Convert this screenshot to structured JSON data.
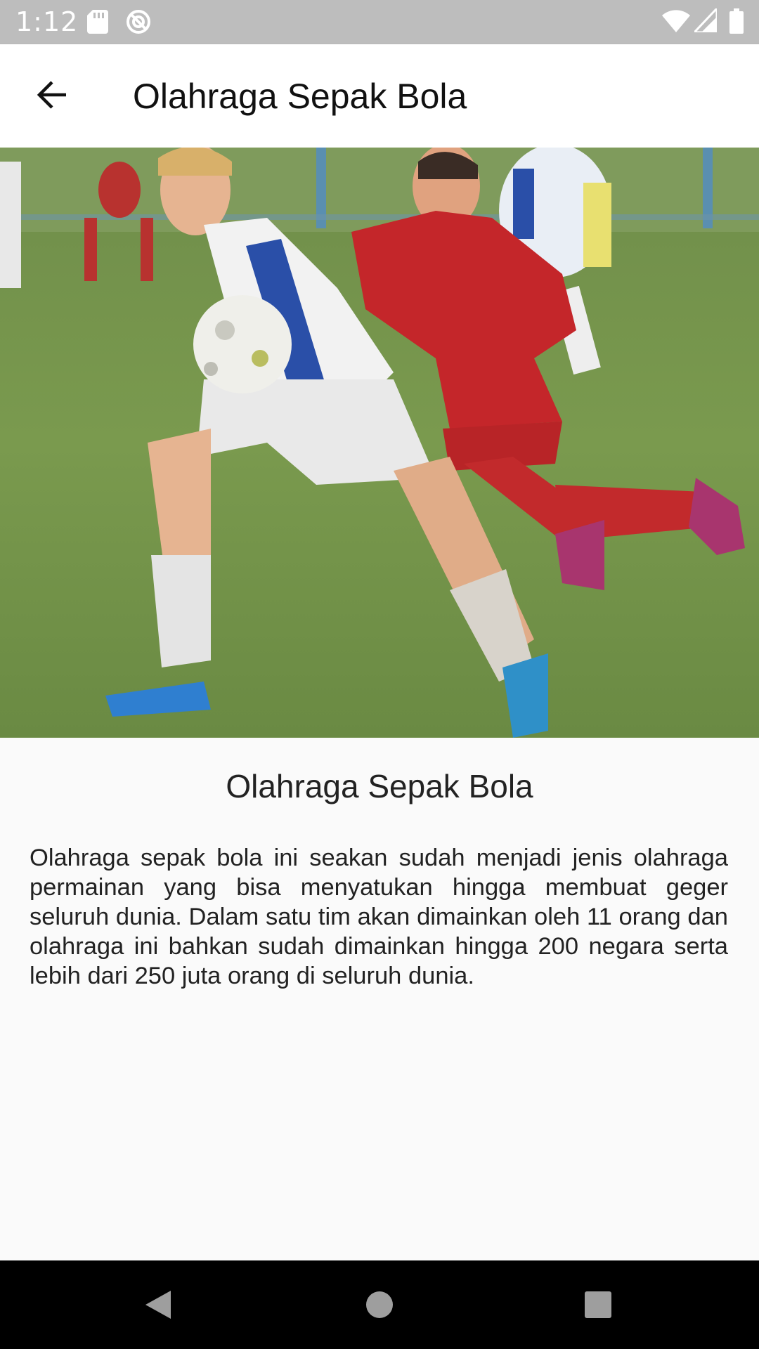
{
  "status_bar": {
    "time": "1:12",
    "icons": [
      "sd-card-icon",
      "sync-disabled-icon",
      "wifi-icon",
      "signal-icon",
      "battery-icon"
    ]
  },
  "app_bar": {
    "title": "Olahraga Sepak Bola",
    "back_icon": "arrow-back-icon"
  },
  "content": {
    "image_subject": "soccer-players-photo",
    "title": "Olahraga Sepak Bola",
    "description": "Olahraga sepak bola ini seakan sudah menjadi jenis olahraga permainan yang bisa menyatukan hingga membuat geger seluruh dunia. Dalam satu tim akan dimainkan oleh 11 orang dan olahraga ini bahkan sudah dimainkan hingga 200 negara serta lebih dari 250 juta orang di seluruh dunia."
  },
  "nav_bar": {
    "icons": [
      "nav-back-icon",
      "nav-home-icon",
      "nav-recents-icon"
    ]
  },
  "colors": {
    "status_bar": "#bdbdbd",
    "app_bar": "#ffffff",
    "background": "#fafafa",
    "nav_bar": "#000000"
  }
}
